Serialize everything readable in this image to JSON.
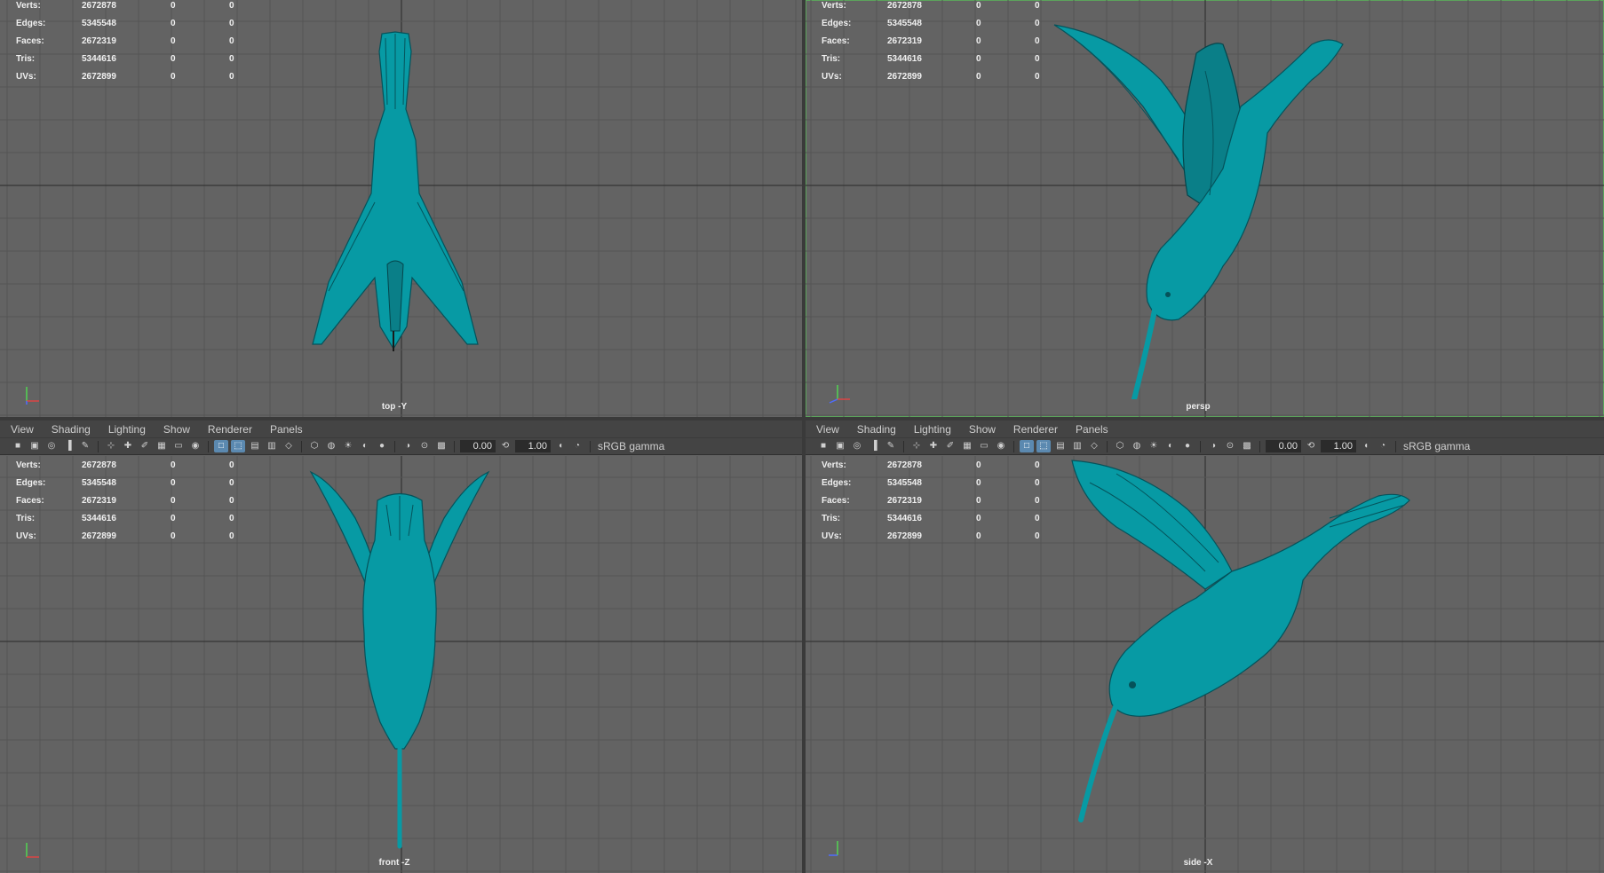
{
  "colors": {
    "model": "#079aa4",
    "background": "#636363",
    "active_outline": "#5ba35b"
  },
  "panels": [
    {
      "id": "top",
      "camera": "top -Y",
      "active": false,
      "stats": [
        {
          "label": "Verts:",
          "v1": "2672878",
          "v2": "0",
          "v3": "0"
        },
        {
          "label": "Edges:",
          "v1": "5345548",
          "v2": "0",
          "v3": "0"
        },
        {
          "label": "Faces:",
          "v1": "2672319",
          "v2": "0",
          "v3": "0"
        },
        {
          "label": "Tris:",
          "v1": "5344616",
          "v2": "0",
          "v3": "0"
        },
        {
          "label": "UVs:",
          "v1": "2672899",
          "v2": "0",
          "v3": "0"
        }
      ]
    },
    {
      "id": "persp",
      "camera": "persp",
      "active": true,
      "stats": [
        {
          "label": "Verts:",
          "v1": "2672878",
          "v2": "0",
          "v3": "0"
        },
        {
          "label": "Edges:",
          "v1": "5345548",
          "v2": "0",
          "v3": "0"
        },
        {
          "label": "Faces:",
          "v1": "2672319",
          "v2": "0",
          "v3": "0"
        },
        {
          "label": "Tris:",
          "v1": "5344616",
          "v2": "0",
          "v3": "0"
        },
        {
          "label": "UVs:",
          "v1": "2672899",
          "v2": "0",
          "v3": "0"
        }
      ]
    },
    {
      "id": "front",
      "camera": "front -Z",
      "active": false,
      "menu": [
        "View",
        "Shading",
        "Lighting",
        "Show",
        "Renderer",
        "Panels"
      ],
      "toolbar": {
        "value1": "0.00",
        "value2": "1.00",
        "color_space": "sRGB gamma"
      },
      "stats": [
        {
          "label": "Verts:",
          "v1": "2672878",
          "v2": "0",
          "v3": "0"
        },
        {
          "label": "Edges:",
          "v1": "5345548",
          "v2": "0",
          "v3": "0"
        },
        {
          "label": "Faces:",
          "v1": "2672319",
          "v2": "0",
          "v3": "0"
        },
        {
          "label": "Tris:",
          "v1": "5344616",
          "v2": "0",
          "v3": "0"
        },
        {
          "label": "UVs:",
          "v1": "2672899",
          "v2": "0",
          "v3": "0"
        }
      ]
    },
    {
      "id": "side",
      "camera": "side -X",
      "active": false,
      "menu": [
        "View",
        "Shading",
        "Lighting",
        "Show",
        "Renderer",
        "Panels"
      ],
      "toolbar": {
        "value1": "0.00",
        "value2": "1.00",
        "color_space": "sRGB gamma"
      },
      "stats": [
        {
          "label": "Verts:",
          "v1": "2672878",
          "v2": "0",
          "v3": "0"
        },
        {
          "label": "Edges:",
          "v1": "5345548",
          "v2": "0",
          "v3": "0"
        },
        {
          "label": "Faces:",
          "v1": "2672319",
          "v2": "0",
          "v3": "0"
        },
        {
          "label": "Tris:",
          "v1": "5344616",
          "v2": "0",
          "v3": "0"
        },
        {
          "label": "UVs:",
          "v1": "2672899",
          "v2": "0",
          "v3": "0"
        }
      ]
    }
  ],
  "toolbar_icons": [
    "camera-select-icon",
    "camera-attributes-icon",
    "bookmark-icon",
    "image-plane-icon",
    "grid-toggle-icon",
    "film-gate-icon",
    "resolution-gate-icon",
    "gate-mask-icon",
    "field-chart-icon",
    "safe-action-icon",
    "safe-title-icon",
    "wireframe-icon",
    "smooth-shade-icon",
    "wireframe-on-shaded-icon",
    "textured-icon",
    "use-all-lights-icon",
    "shadows-icon",
    "ambient-occlusion-icon",
    "motion-blur-icon",
    "anti-alias-icon",
    "isolate-select-icon",
    "xray-icon",
    "xray-joints-icon",
    "backface-icon",
    "exposure-icon",
    "gamma-icon",
    "color-management-icon"
  ]
}
